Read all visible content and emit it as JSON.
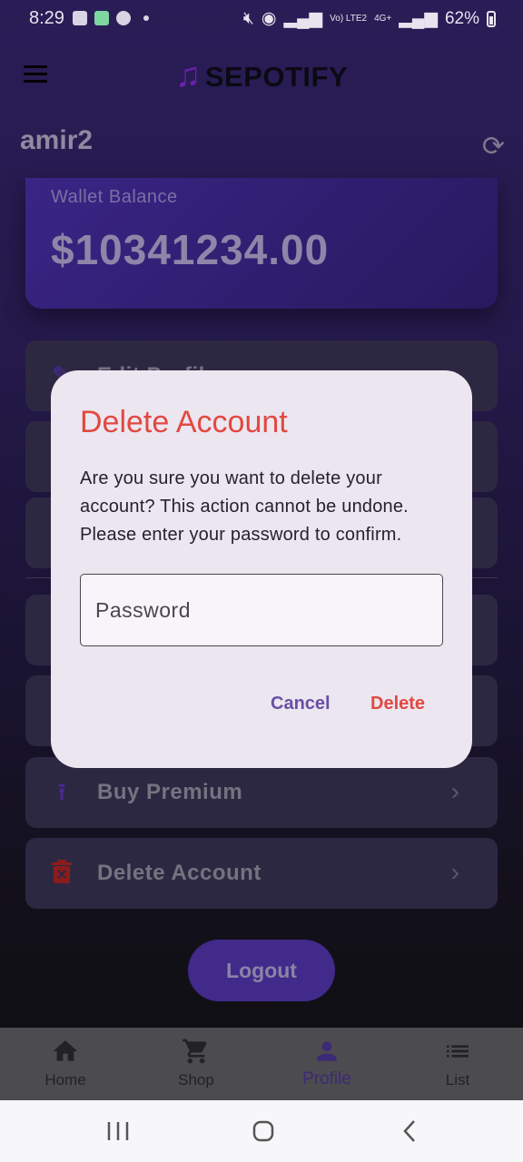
{
  "status_bar": {
    "time": "8:29",
    "network_small_1": "Vo) LTE2",
    "network_small_2": "4G+",
    "battery": "62%"
  },
  "app_bar": {
    "title": "SEPOTIFY"
  },
  "profile": {
    "username": "amir2"
  },
  "wallet": {
    "label": "Wallet Balance",
    "amount": "$10341234.00"
  },
  "menu": {
    "items": [
      {
        "label": "Edit Profile",
        "icon": "edit-icon"
      },
      {
        "label": "",
        "icon": "card-icon"
      },
      {
        "label": "",
        "icon": "language-icon"
      },
      {
        "label": "",
        "icon": "upload-icon"
      },
      {
        "label": "",
        "icon": "download-icon"
      },
      {
        "label": "Buy Premium",
        "icon": "upgrade-icon"
      },
      {
        "label": "Delete Account",
        "icon": "trash-icon"
      }
    ]
  },
  "logout": {
    "label": "Logout"
  },
  "bottom_nav": {
    "items": [
      {
        "label": "Home",
        "icon": "home-icon"
      },
      {
        "label": "Shop",
        "icon": "cart-icon"
      },
      {
        "label": "Profile",
        "icon": "person-icon",
        "active": true
      },
      {
        "label": "List",
        "icon": "list-icon"
      }
    ]
  },
  "dialog": {
    "title": "Delete Account",
    "message": "Are you sure you want to delete your account? This action cannot be undone. Please enter your password to confirm.",
    "password_placeholder": "Password",
    "password_value": "",
    "cancel_label": "Cancel",
    "delete_label": "Delete"
  },
  "colors": {
    "accent": "#412a8a",
    "danger": "#e24840",
    "dialog_bg": "#ece6f0"
  }
}
